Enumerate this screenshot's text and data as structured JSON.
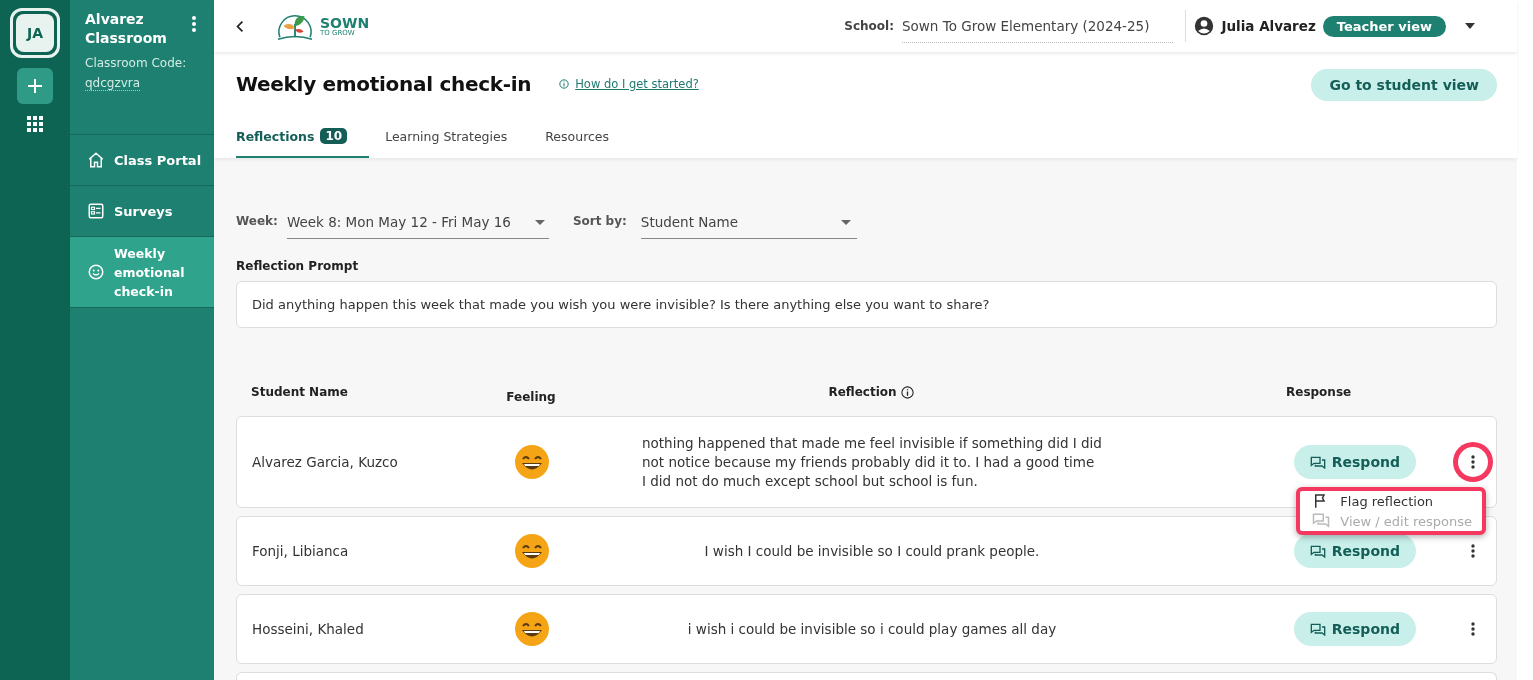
{
  "rail": {
    "avatar": "JA"
  },
  "sidebar": {
    "classroom": "Alvarez Classroom",
    "code_label": "Classroom Code:",
    "code": "qdcgzvra",
    "items": [
      {
        "label": "Class Portal",
        "kind": "home",
        "selected": false
      },
      {
        "label": "Surveys",
        "kind": "survey",
        "selected": false
      },
      {
        "label": "Weekly emotional check-in",
        "kind": "smile",
        "selected": true
      }
    ]
  },
  "topbar": {
    "logo_top": "SOWN",
    "logo_bottom": "TO GROW",
    "school_label": "School:",
    "school": "Sown To Grow Elementary (2024-25)",
    "user": "Julia Alvarez",
    "view_badge": "Teacher view"
  },
  "page": {
    "title": "Weekly emotional check-in",
    "help_link": "How do I get started?",
    "student_view_button": "Go to student view",
    "tabs": [
      {
        "label": "Reflections",
        "count": "10",
        "selected": true
      },
      {
        "label": "Learning Strategies",
        "selected": false
      },
      {
        "label": "Resources",
        "selected": false
      }
    ]
  },
  "filters": {
    "week_label": "Week:",
    "week": "Week 8: Mon May 12 - Fri May 16",
    "sort_label": "Sort by:",
    "sort": "Student Name"
  },
  "prompt": {
    "label": "Reflection Prompt",
    "text": "Did anything happen this week that made you wish you were invisible? Is there anything else you want to share?"
  },
  "table": {
    "columns": [
      "Student Name",
      "Feeling",
      "Reflection",
      "Response"
    ],
    "rows": [
      {
        "name": "Alvarez Garcia, Kuzco",
        "reflection": "nothing happened that made me feel invisible if something did I did not notice because my friends probably did it to. I had a good time I did not do much except school but school is fun.",
        "respond": "Respond",
        "menu_open": true
      },
      {
        "name": "Fonji, Libianca",
        "reflection": "I wish I could be invisible so I could prank people.",
        "respond": "Respond",
        "menu_open": false
      },
      {
        "name": "Hosseini, Khaled",
        "reflection": "i wish i could be invisible so i could play games all day",
        "respond": "Respond",
        "menu_open": false
      }
    ]
  },
  "row_menu": {
    "items": [
      {
        "label": "Flag reflection",
        "kind": "flag",
        "disabled": false
      },
      {
        "label": "View / edit response",
        "kind": "chat",
        "disabled": true
      }
    ]
  }
}
